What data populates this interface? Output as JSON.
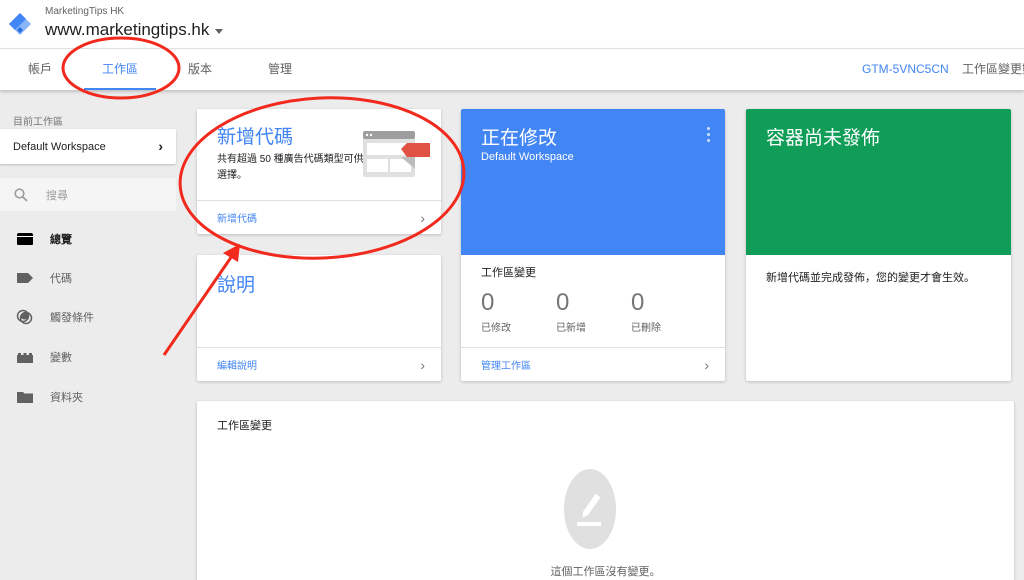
{
  "header": {
    "account_name": "MarketingTips HK",
    "container_name": "www.marketingtips.hk",
    "logo_icon": "gtm-diamond-icon"
  },
  "nav": {
    "tabs": [
      {
        "label": "帳戶",
        "active": false
      },
      {
        "label": "工作區",
        "active": true
      },
      {
        "label": "版本",
        "active": false
      },
      {
        "label": "管理",
        "active": false
      }
    ],
    "container_id": "GTM-5VNC5CN",
    "workspace_changes": "工作區變更數"
  },
  "sidebar": {
    "current_workspace_label": "目前工作區",
    "current_workspace": "Default Workspace",
    "search_placeholder": "搜尋",
    "items": [
      {
        "label": "總覽",
        "icon": "overview-icon",
        "active": true
      },
      {
        "label": "代碼",
        "icon": "tag-icon",
        "active": false
      },
      {
        "label": "觸發條件",
        "icon": "trigger-icon",
        "active": false
      },
      {
        "label": "變數",
        "icon": "variable-icon",
        "active": false
      },
      {
        "label": "資料夾",
        "icon": "folder-icon",
        "active": false
      }
    ]
  },
  "cards": {
    "add_tag": {
      "title": "新增代碼",
      "description": "共有超過 50 種廣告代碼類型可供選擇。",
      "link": "新增代碼"
    },
    "description": {
      "title": "說明",
      "link": "編輯說明"
    },
    "editing": {
      "title": "正在修改",
      "workspace": "Default Workspace",
      "section_title": "工作區變更",
      "stats": [
        {
          "value": "0",
          "label": "已修改"
        },
        {
          "value": "0",
          "label": "已新增"
        },
        {
          "value": "0",
          "label": "已刪除"
        }
      ],
      "link": "管理工作區",
      "color": "#4285f4"
    },
    "publish": {
      "title": "容器尚未發佈",
      "body": "新增代碼並完成發佈，您的變更才會生效。",
      "color": "#0f9d58"
    },
    "workspace_changes": {
      "title": "工作區變更",
      "empty_text": "這個工作區沒有變更。"
    }
  },
  "annotations": {
    "color": "#f2291d",
    "circled": [
      "tab-workspace",
      "add-tag-card"
    ],
    "arrow_target": "add-tag-card"
  }
}
